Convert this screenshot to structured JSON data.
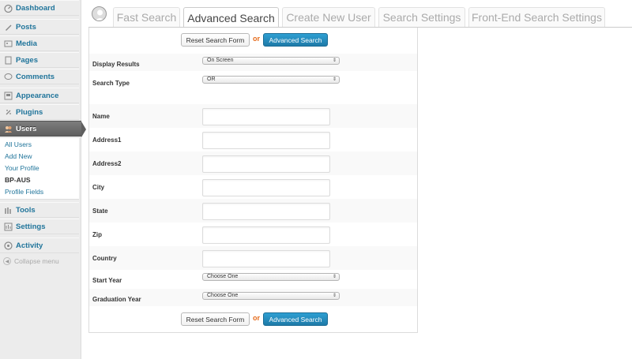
{
  "sidebar": {
    "items": [
      {
        "label": "Dashboard",
        "icon": "dashboard-icon"
      },
      {
        "label": "Posts",
        "icon": "posts-icon"
      },
      {
        "label": "Media",
        "icon": "media-icon"
      },
      {
        "label": "Pages",
        "icon": "pages-icon"
      },
      {
        "label": "Comments",
        "icon": "comments-icon"
      },
      {
        "label": "Appearance",
        "icon": "appearance-icon"
      },
      {
        "label": "Plugins",
        "icon": "plugins-icon"
      },
      {
        "label": "Users",
        "icon": "users-icon"
      },
      {
        "label": "Tools",
        "icon": "tools-icon"
      },
      {
        "label": "Settings",
        "icon": "settings-icon"
      },
      {
        "label": "Activity",
        "icon": "activity-icon"
      }
    ],
    "submenu": [
      "All Users",
      "Add New",
      "Your Profile",
      "BP-AUS",
      "Profile Fields"
    ],
    "collapse": "Collapse menu"
  },
  "tabs": [
    "Fast Search",
    "Advanced Search",
    "Create New User",
    "Search Settings",
    "Front-End Search Settings"
  ],
  "form": {
    "reset_label": "Reset Search Form",
    "or_label": "or",
    "search_label": "Advanced Search",
    "display_results": {
      "label": "Display Results",
      "value": "On Screen"
    },
    "search_type": {
      "label": "Search Type",
      "value": "OR"
    },
    "fields": [
      "Name",
      "Address1",
      "Address2",
      "City",
      "State",
      "Zip",
      "Country"
    ],
    "start_year": {
      "label": "Start Year",
      "value": "Choose One"
    },
    "graduation_year": {
      "label": "Graduation Year",
      "value": "Choose One"
    }
  },
  "colors": {
    "accent": "#21759b",
    "primary_button": "#2580b8",
    "or_text": "#e66c1c",
    "current_menu": "#6d6d6d"
  }
}
